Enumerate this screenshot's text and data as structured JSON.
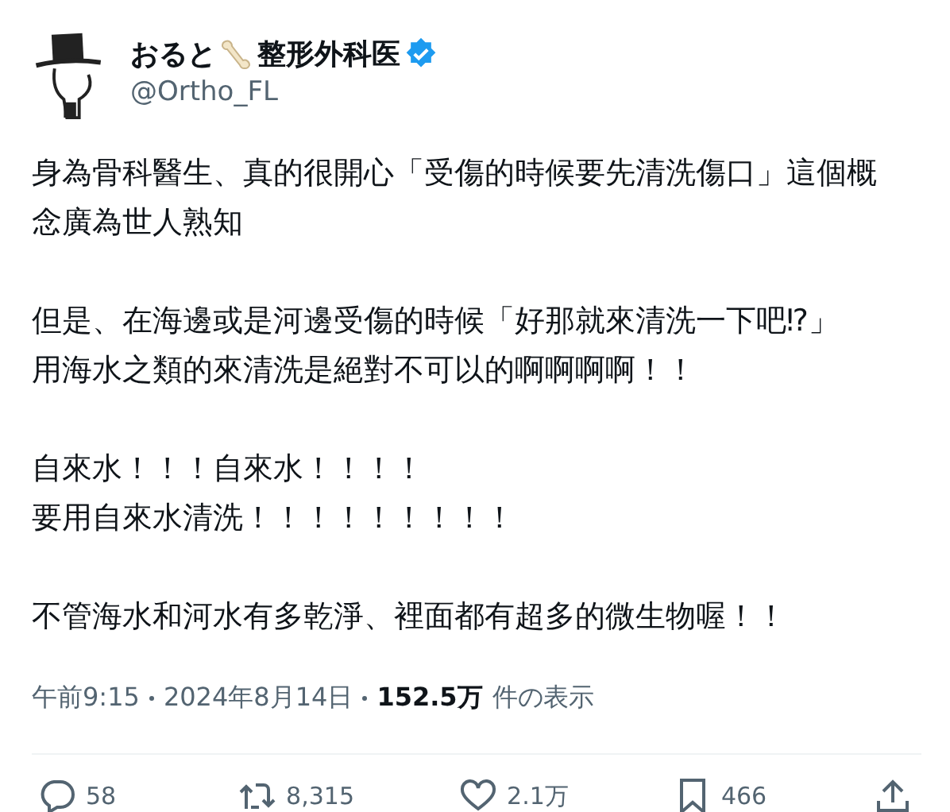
{
  "author": {
    "name_before": "おると",
    "name_after": "整形外科医",
    "verified": true,
    "handle": "@Ortho_FL"
  },
  "paragraphs": [
    [
      "身為骨科醫生、真的很開心「受傷的時候要先清洗傷口」這個概",
      "念廣為世人熟知"
    ],
    [
      "但是、在海邊或是河邊受傷的時候「好那就來清洗一下吧⁉」",
      "用海水之類的來清洗是絕對不可以的啊啊啊啊！！"
    ],
    [
      "自來水！！！自來水！！！！",
      "要用自來水清洗！！！！！！！！！"
    ],
    [
      "不管海水和河水有多乾淨、裡面都有超多的微生物喔！！"
    ]
  ],
  "meta": {
    "time": "午前9:15",
    "date": "2024年8月14日",
    "views": "152.5万",
    "views_label": "件の表示"
  },
  "actions": [
    {
      "kind": "reply",
      "count": "58"
    },
    {
      "kind": "repost",
      "count": "8,315"
    },
    {
      "kind": "like",
      "count": "2.1万"
    },
    {
      "kind": "bookmark",
      "count": "466"
    },
    {
      "kind": "share"
    }
  ]
}
